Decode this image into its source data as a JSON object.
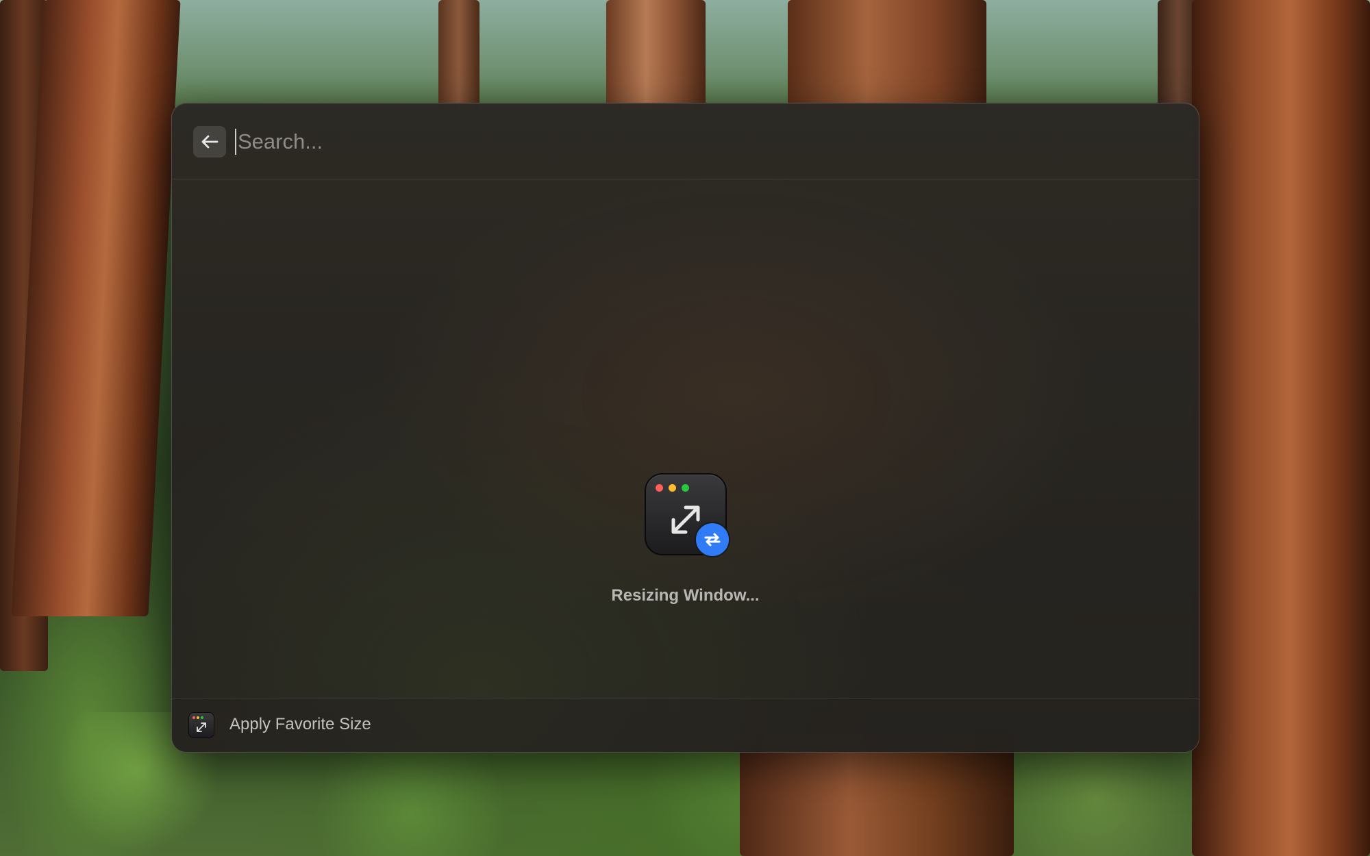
{
  "search": {
    "placeholder": "Search...",
    "value": ""
  },
  "header": {
    "back_icon": "arrow-left-icon"
  },
  "main": {
    "app_icon": "window-resize-icon",
    "badge_icon": "refresh-arrows-icon",
    "status_text": "Resizing Window..."
  },
  "footer": {
    "action_icon": "window-resize-icon",
    "action_label": "Apply Favorite Size"
  },
  "colors": {
    "accent": "#2f7cf6",
    "traffic_red": "#ff5f57",
    "traffic_yellow": "#febc2e",
    "traffic_green": "#28c840"
  }
}
